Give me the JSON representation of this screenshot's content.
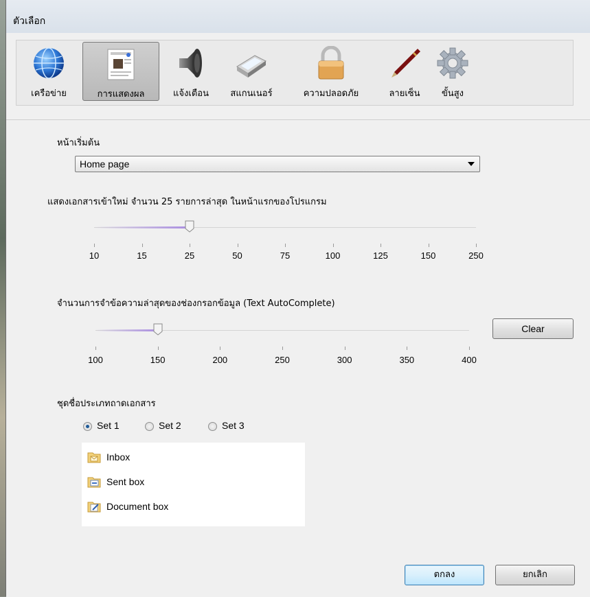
{
  "window": {
    "title": "ตัวเลือก"
  },
  "toolbar": {
    "items": [
      {
        "label": "เครือข่าย",
        "icon": "globe-icon"
      },
      {
        "label": "การแสดงผล",
        "icon": "display-page-icon",
        "selected": true
      },
      {
        "label": "แจ้งเตือน",
        "icon": "speaker-icon"
      },
      {
        "label": "สแกนเนอร์",
        "icon": "scanner-icon"
      },
      {
        "label": "ความปลอดภัย",
        "icon": "lock-icon"
      },
      {
        "label": "ลายเซ็น",
        "icon": "pen-icon"
      },
      {
        "label": "ขั้นสูง",
        "icon": "gear-icon"
      }
    ]
  },
  "start_page": {
    "label": "หน้าเริ่มต้น",
    "selected": "Home page"
  },
  "recent_docs": {
    "label": "แสดงเอกสารเข้าใหม่ จำนวน 25 รายการล่าสุด ในหน้าแรกของโปรแกรม",
    "ticks": [
      "10",
      "15",
      "25",
      "50",
      "75",
      "100",
      "125",
      "150",
      "250"
    ],
    "selected_index": 2
  },
  "autocomplete": {
    "label": "จำนวนการจำข้อความล่าสุดของช่องกรอกข้อมูล (Text AutoComplete)",
    "ticks": [
      "100",
      "150",
      "200",
      "250",
      "300",
      "350",
      "400"
    ],
    "selected_index": 1,
    "clear_label": "Clear"
  },
  "tray_sets": {
    "label": "ชุดชื่อประเภทถาดเอกสาร",
    "options": [
      "Set 1",
      "Set 2",
      "Set 3"
    ],
    "selected_index": 0,
    "trays": [
      {
        "label": "Inbox",
        "icon": "inbox-folder-icon"
      },
      {
        "label": "Sent box",
        "icon": "sent-folder-icon"
      },
      {
        "label": "Document box",
        "icon": "document-folder-icon"
      }
    ]
  },
  "buttons": {
    "ok": "ตกลง",
    "cancel": "ยกเลิก"
  },
  "colors": {
    "accent": "#3c7fb1",
    "slider_fill": "#a98de0"
  }
}
